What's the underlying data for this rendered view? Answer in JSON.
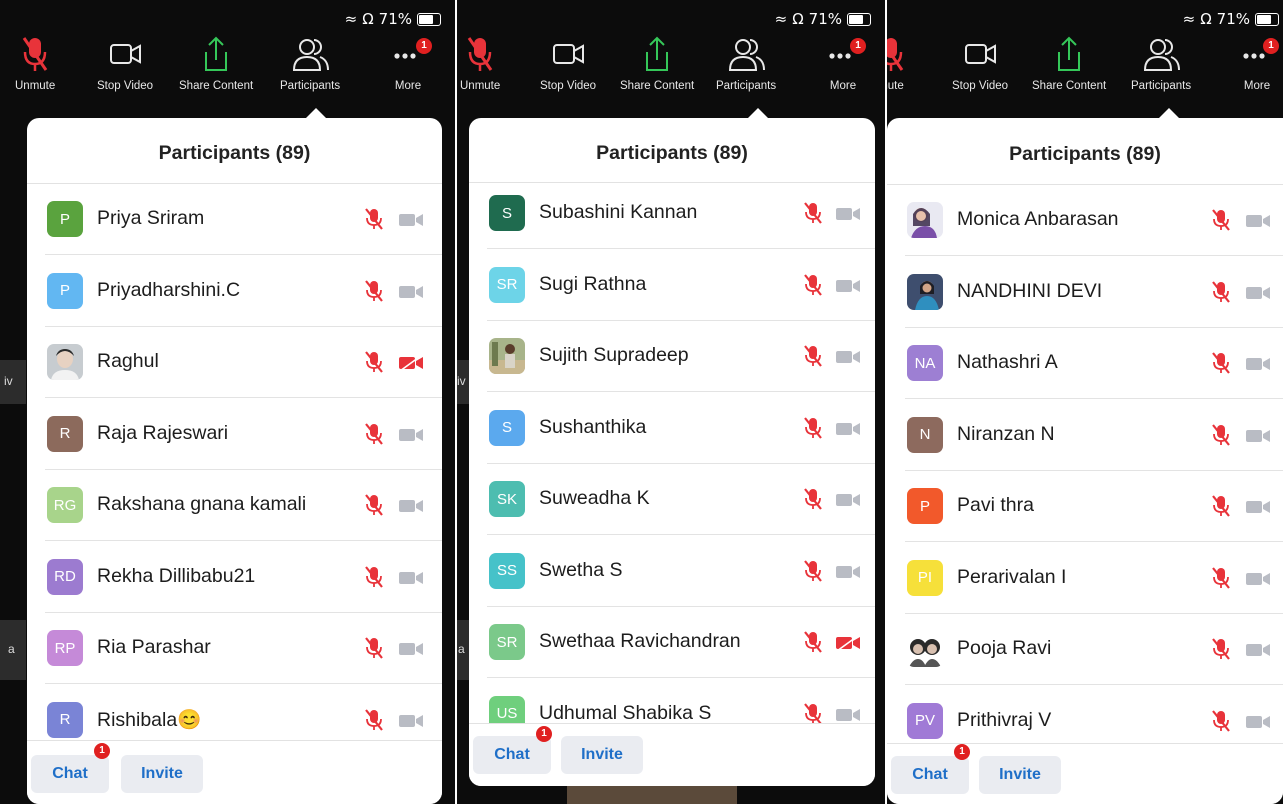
{
  "status": {
    "battery": "71%"
  },
  "toolbar": {
    "unmute": "Unmute",
    "unmute_cropped": "mute",
    "stop_video": "Stop Video",
    "share": "Share Content",
    "participants": "Participants",
    "more": "More",
    "more_badge": "1"
  },
  "sheet": {
    "title": "Participants (89)"
  },
  "bottom": {
    "chat": "Chat",
    "invite": "Invite",
    "chat_badge": "1"
  },
  "side_text": {
    "p1_a": "iv",
    "p1_b": "a",
    "p2_a": "iv",
    "p2_b": "a"
  },
  "colors": {
    "muted_red": "#e8333a",
    "accent_blue": "#1f6fc8",
    "badge_red": "#e02020",
    "share_green": "#35c759"
  },
  "panels": [
    {
      "participants": [
        {
          "name": "Priya Sriram",
          "initials": "P",
          "color": "#5aa33e",
          "video_off": false
        },
        {
          "name": "Priyadharshini.C",
          "initials": "P",
          "color": "#62b7f2",
          "video_off": false
        },
        {
          "name": "Raghul",
          "initials": "",
          "photo": "photo-boy",
          "video_off": true
        },
        {
          "name": "Raja Rajeswari",
          "initials": "R",
          "color": "#8c6a5c",
          "video_off": false
        },
        {
          "name": "Rakshana gnana kamali",
          "initials": "RG",
          "color": "#a8d48b",
          "video_off": false
        },
        {
          "name": "Rekha Dillibabu21",
          "initials": "RD",
          "color": "#9c7bd0",
          "video_off": false
        },
        {
          "name": "Ria Parashar",
          "initials": "RP",
          "color": "#c58ad8",
          "video_off": false
        },
        {
          "name": "Rishibala😊",
          "initials": "R",
          "color": "#7a84d6",
          "video_off": false
        }
      ]
    },
    {
      "participants": [
        {
          "name": "Subashini Kannan",
          "initials": "S",
          "color": "#1f6b4f",
          "video_off": false
        },
        {
          "name": "Sugi Rathna",
          "initials": "SR",
          "color": "#6dd4e8",
          "video_off": false
        },
        {
          "name": "Sujith Supradeep",
          "initials": "",
          "photo": "photo-outdoor",
          "video_off": false
        },
        {
          "name": "Sushanthika",
          "initials": "S",
          "color": "#5ba9ee",
          "video_off": false
        },
        {
          "name": "Suweadha K",
          "initials": "SK",
          "color": "#4dbdb0",
          "video_off": false
        },
        {
          "name": "Swetha S",
          "initials": "SS",
          "color": "#46c2c9",
          "video_off": false
        },
        {
          "name": "Swethaa Ravichandran",
          "initials": "SR",
          "color": "#7bc98a",
          "video_off": true
        },
        {
          "name": "Udhumal Shabika S",
          "initials": "US",
          "color": "#6fcf7d",
          "video_off": false
        }
      ]
    },
    {
      "participants": [
        {
          "name": "Monica Anbarasan",
          "initials": "",
          "photo": "photo-girl",
          "video_off": false
        },
        {
          "name": "NANDHINI DEVI",
          "initials": "",
          "photo": "photo-woman",
          "video_off": false
        },
        {
          "name": "Nathashri A",
          "initials": "NA",
          "color": "#9d7fd3",
          "video_off": false
        },
        {
          "name": "Niranzan N",
          "initials": "N",
          "color": "#8d6a5e",
          "video_off": false
        },
        {
          "name": "Pavi thra",
          "initials": "P",
          "color": "#f2592b",
          "video_off": false
        },
        {
          "name": "Perarivalan I",
          "initials": "PI",
          "color": "#f6e03a",
          "video_off": false
        },
        {
          "name": "Pooja Ravi",
          "initials": "",
          "photo": "photo-couple",
          "video_off": false
        },
        {
          "name": "Prithivraj V",
          "initials": "PV",
          "color": "#a07ad6",
          "video_off": false
        }
      ]
    }
  ]
}
